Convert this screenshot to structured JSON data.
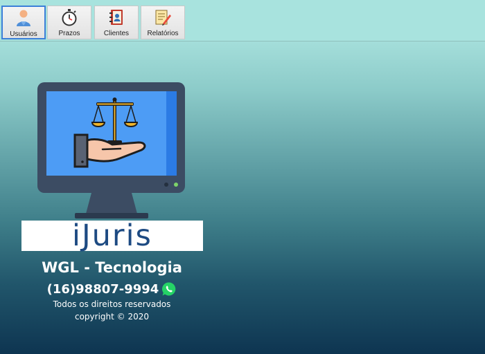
{
  "toolbar": {
    "buttons": [
      {
        "label": "Usuários",
        "icon": "user-icon"
      },
      {
        "label": "Prazos",
        "icon": "stopwatch-icon"
      },
      {
        "label": "Clientes",
        "icon": "address-book-icon"
      },
      {
        "label": "Relatórios",
        "icon": "report-pencil-icon"
      }
    ]
  },
  "logo": {
    "icon": "monitor-scales-of-justice-icon",
    "brand_name": "iJuris"
  },
  "footer": {
    "company": "WGL - Tecnologia",
    "phone": "(16)98807-9994",
    "phone_icon": "whatsapp-icon",
    "rights": "Todos os direitos reservados",
    "copyright": "copyright © 2020"
  },
  "colors": {
    "background_top": "#a8e2dd",
    "background_bottom": "#0e3551",
    "brand_text": "#1d4a82",
    "screen_blue": "#4d9cf5"
  }
}
